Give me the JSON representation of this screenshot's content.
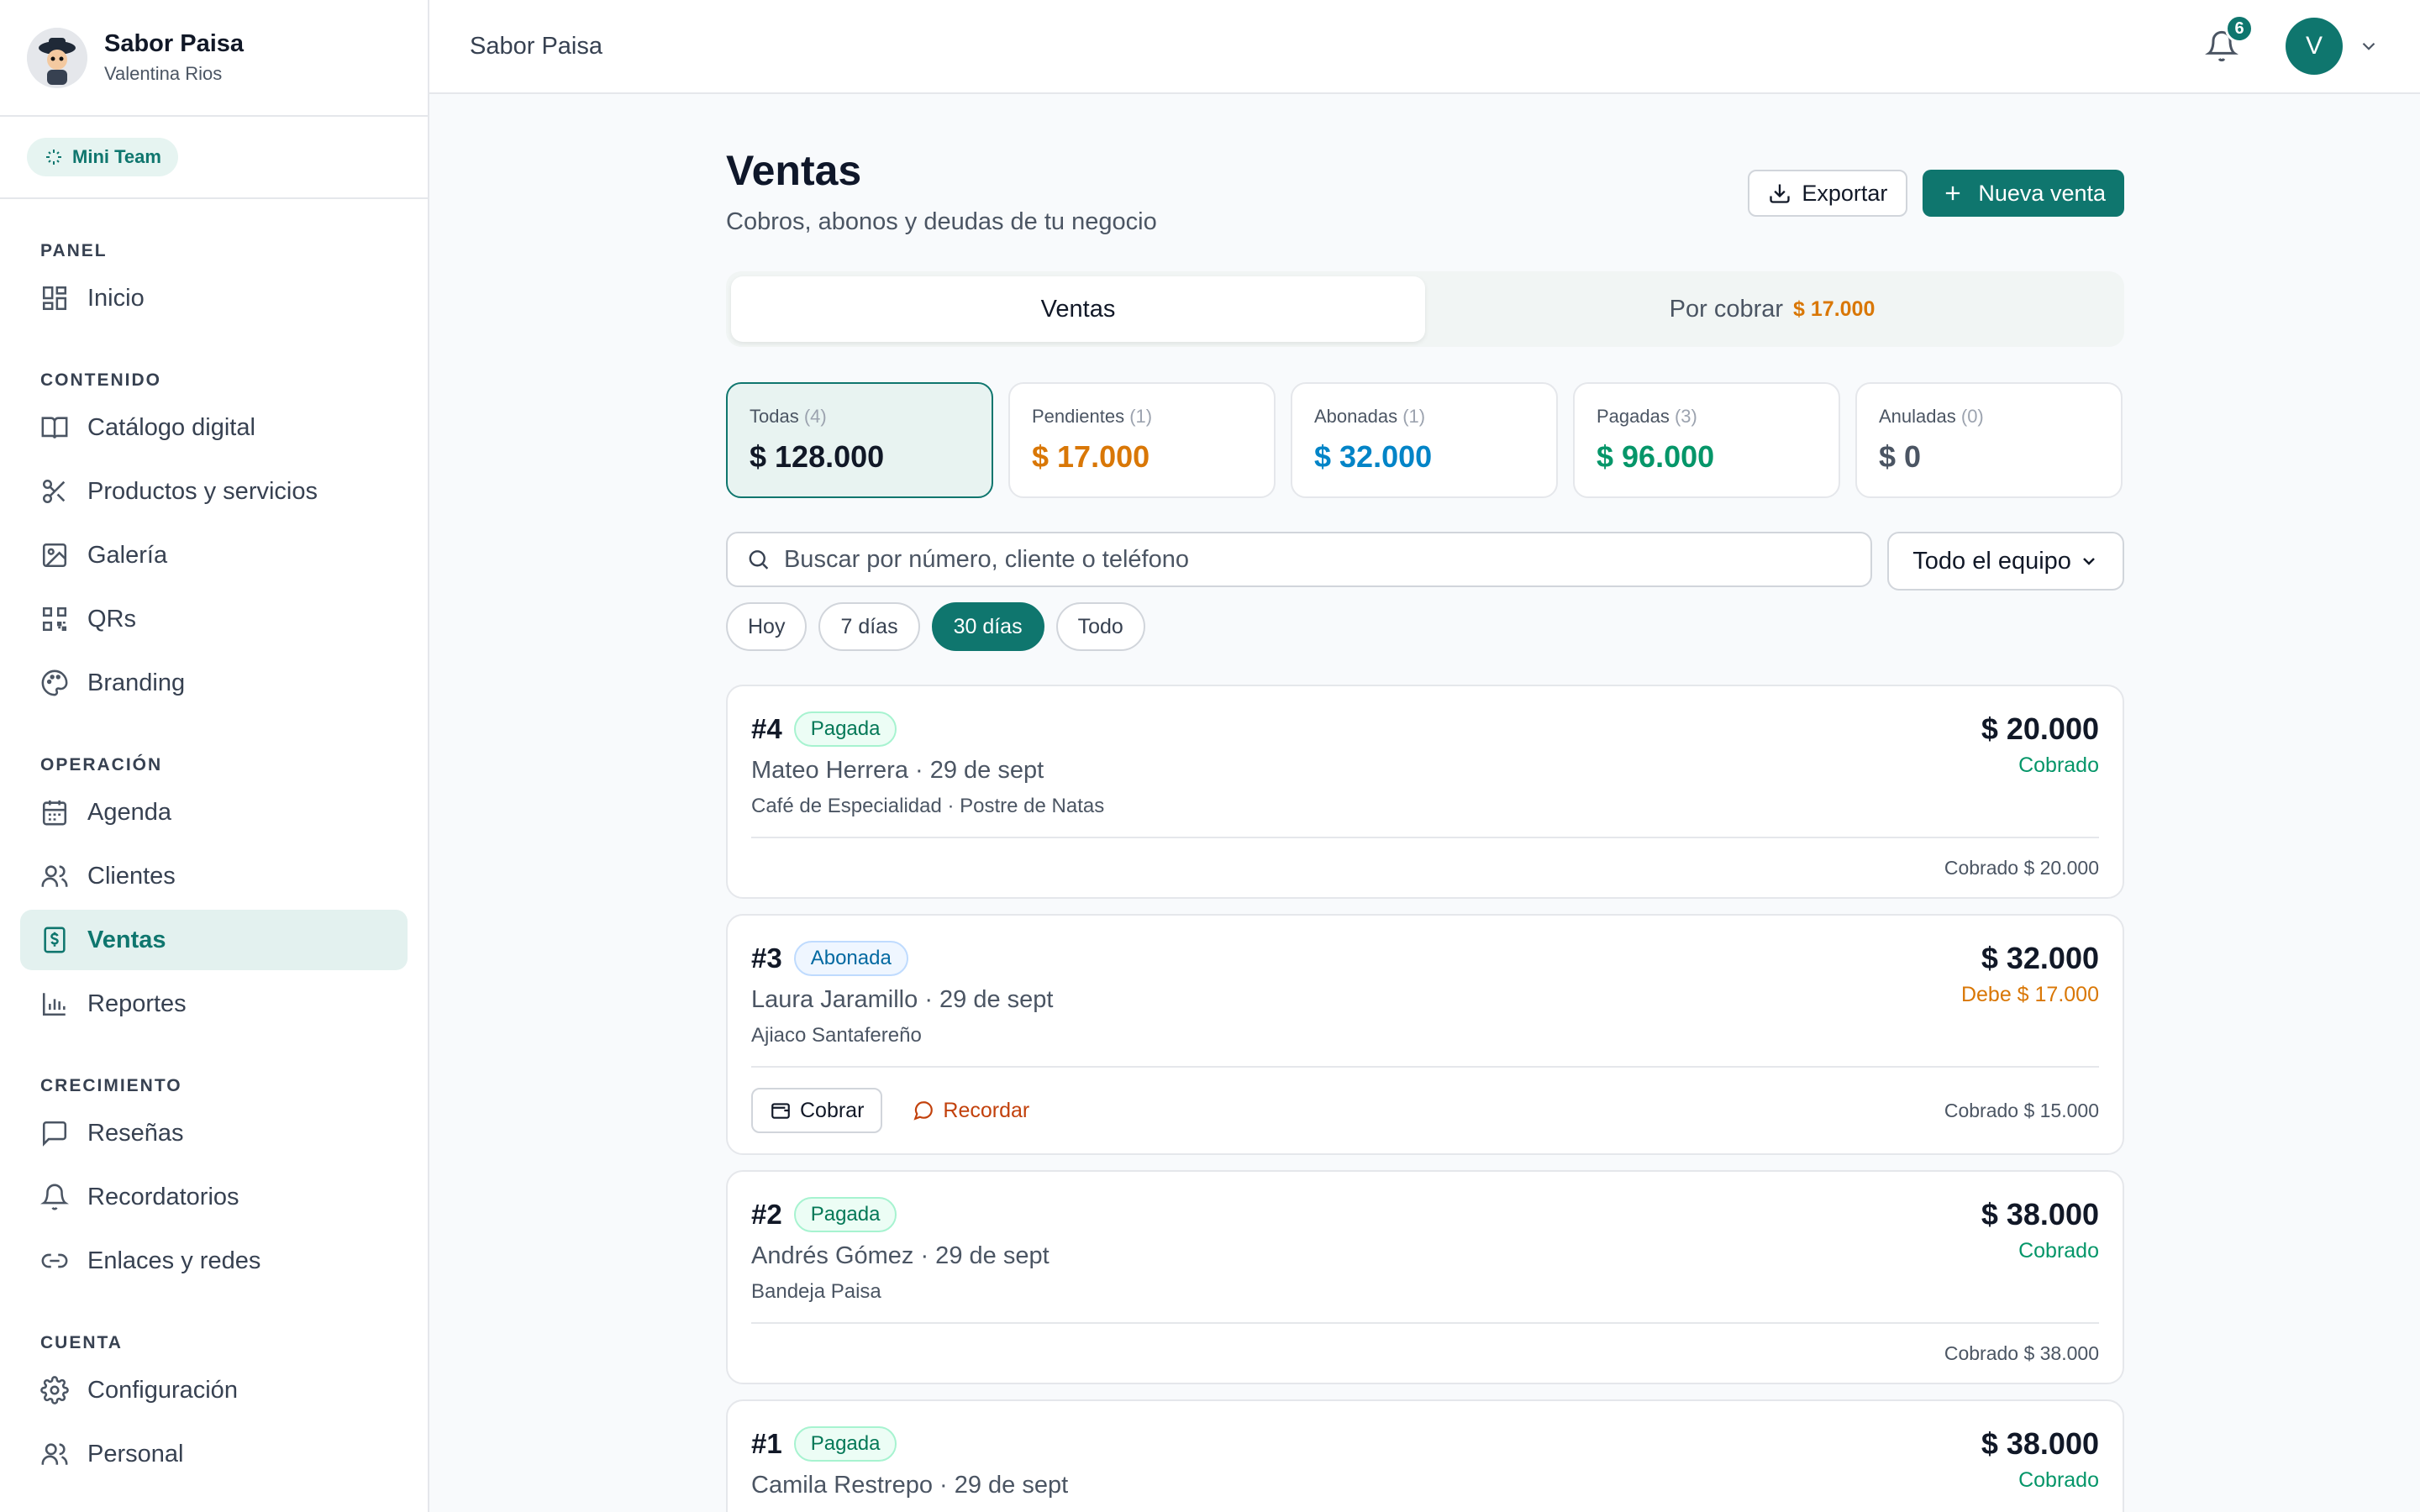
{
  "brand": {
    "name": "Sabor Paisa",
    "user": "Valentina Rios"
  },
  "team": {
    "label": "Mini Team"
  },
  "sidebar": {
    "sections": [
      {
        "title": "PANEL",
        "items": [
          {
            "label": "Inicio",
            "icon": "grid-icon"
          }
        ]
      },
      {
        "title": "CONTENIDO",
        "items": [
          {
            "label": "Catálogo digital",
            "icon": "book-icon"
          },
          {
            "label": "Productos y servicios",
            "icon": "scissors-icon"
          },
          {
            "label": "Galería",
            "icon": "image-icon"
          },
          {
            "label": "QRs",
            "icon": "qr-icon"
          },
          {
            "label": "Branding",
            "icon": "palette-icon"
          }
        ]
      },
      {
        "title": "OPERACIÓN",
        "items": [
          {
            "label": "Agenda",
            "icon": "calendar-icon"
          },
          {
            "label": "Clientes",
            "icon": "users-icon"
          },
          {
            "label": "Ventas",
            "icon": "receipt-icon"
          },
          {
            "label": "Reportes",
            "icon": "bar-chart-icon"
          }
        ]
      },
      {
        "title": "CRECIMIENTO",
        "items": [
          {
            "label": "Reseñas",
            "icon": "message-icon"
          },
          {
            "label": "Recordatorios",
            "icon": "bell-icon"
          },
          {
            "label": "Enlaces y redes",
            "icon": "link-icon"
          }
        ]
      },
      {
        "title": "CUENTA",
        "items": [
          {
            "label": "Configuración",
            "icon": "gear-icon"
          },
          {
            "label": "Personal",
            "icon": "users-icon"
          }
        ]
      }
    ]
  },
  "topbar": {
    "title": "Sabor Paisa",
    "notifications": "6",
    "avatar_letter": "V"
  },
  "page": {
    "title": "Ventas",
    "subtitle": "Cobros, abonos y deudas de tu negocio",
    "export_label": "Exportar",
    "new_sale_label": "Nueva venta"
  },
  "tabs": [
    {
      "label": "Ventas",
      "amount": ""
    },
    {
      "label": "Por cobrar",
      "amount": "$ 17.000"
    }
  ],
  "stats": [
    {
      "label": "Todas",
      "count": "(4)",
      "value": "$ 128.000",
      "color": "#111827"
    },
    {
      "label": "Pendientes",
      "count": "(1)",
      "value": "$ 17.000",
      "color": "#d97706"
    },
    {
      "label": "Abonadas",
      "count": "(1)",
      "value": "$ 32.000",
      "color": "#0284c7"
    },
    {
      "label": "Pagadas",
      "count": "(3)",
      "value": "$ 96.000",
      "color": "#059669"
    },
    {
      "label": "Anuladas",
      "count": "(0)",
      "value": "$ 0",
      "color": "#4b5563"
    }
  ],
  "search": {
    "placeholder": "Buscar por número, cliente o teléfono"
  },
  "team_filter": {
    "selected": "Todo el equipo"
  },
  "ranges": [
    "Hoy",
    "7 días",
    "30 días",
    "Todo"
  ],
  "sales": [
    {
      "id": "#4",
      "status": "Pagada",
      "client": "Mateo Herrera · 29 de sept",
      "items": "Café de Especialidad · Postre de Natas",
      "amount": "$ 20.000",
      "state": "Cobrado",
      "footer": "Cobrado $ 20.000"
    },
    {
      "id": "#3",
      "status": "Abonada",
      "client": "Laura Jaramillo · 29 de sept",
      "items": "Ajiaco Santafereño",
      "amount": "$ 32.000",
      "state": "Debe $ 17.000",
      "footer": "Cobrado $ 15.000",
      "charge_label": "Cobrar",
      "remind_label": "Recordar"
    },
    {
      "id": "#2",
      "status": "Pagada",
      "client": "Andrés Gómez · 29 de sept",
      "items": "Bandeja Paisa",
      "amount": "$ 38.000",
      "state": "Cobrado",
      "footer": "Cobrado $ 38.000"
    },
    {
      "id": "#1",
      "status": "Pagada",
      "client": "Camila Restrepo · 29 de sept",
      "items": "",
      "amount": "$ 38.000",
      "state": "Cobrado",
      "footer": ""
    }
  ]
}
